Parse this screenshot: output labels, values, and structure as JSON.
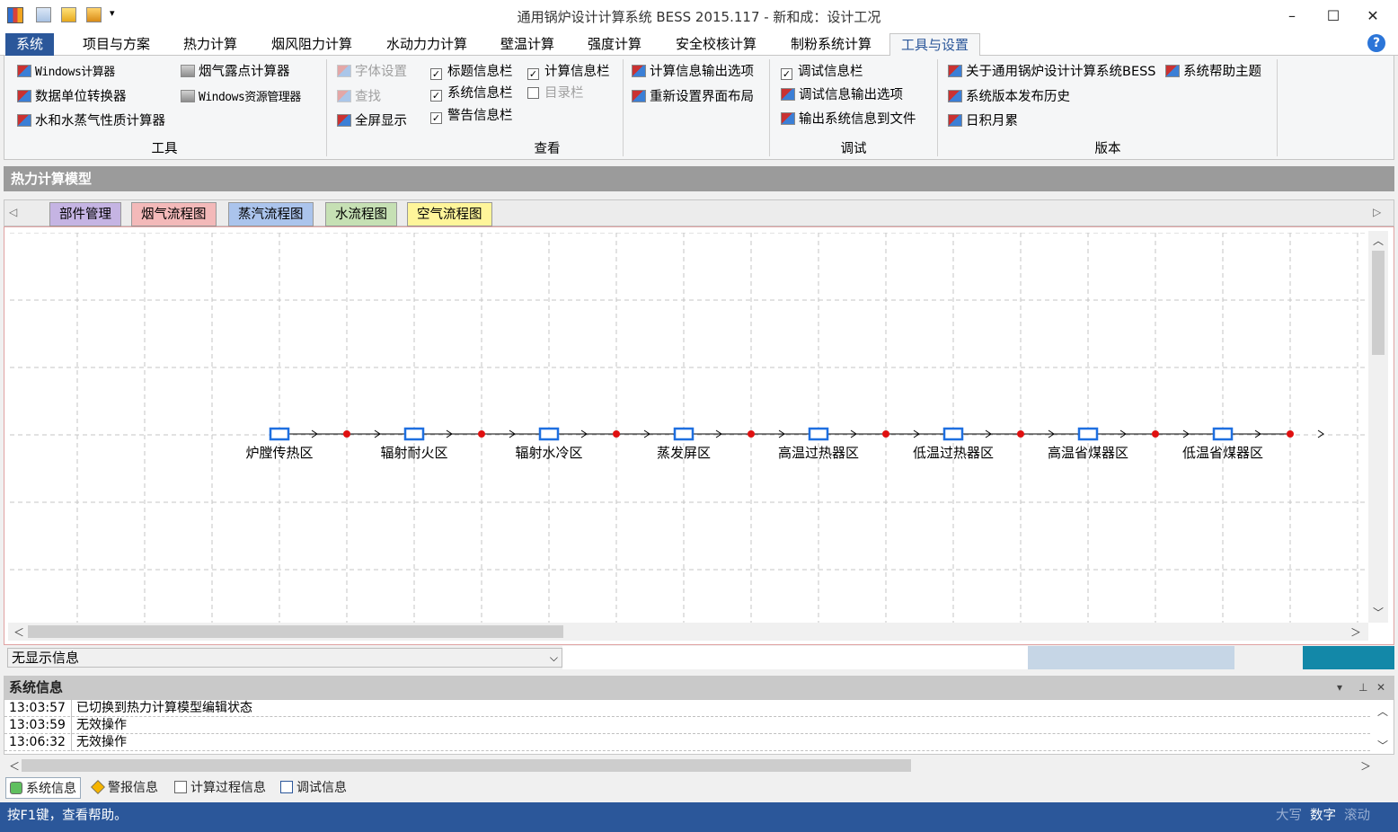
{
  "window": {
    "title": "通用锅炉设计计算系统 BESS 2015.117 - 新和成：设计工况",
    "minimize": "–",
    "maximize": "☐",
    "close": "✕",
    "help": "?"
  },
  "menu_tabs": [
    "系统",
    "项目与方案",
    "热力计算",
    "烟风阻力计算",
    "水动力力计算",
    "壁温计算",
    "强度计算",
    "安全校核计算",
    "制粉系统计算",
    "工具与设置"
  ],
  "ribbon": {
    "tools": {
      "label": "工具",
      "items": [
        "Windows计算器",
        "数据单位转换器",
        "水和水蒸气性质计算器",
        "烟气露点计算器",
        "Windows资源管理器"
      ]
    },
    "view": {
      "label": "查看",
      "items": [
        "字体设置",
        "查找",
        "全屏显示"
      ],
      "checks": [
        {
          "label": "标题信息栏",
          "checked": true
        },
        {
          "label": "系统信息栏",
          "checked": true
        },
        {
          "label": "警告信息栏",
          "checked": true
        },
        {
          "label": "计算信息栏",
          "checked": true
        },
        {
          "label": "目录栏",
          "checked": false
        }
      ],
      "more": [
        "计算信息输出选项",
        "重新设置界面布局"
      ]
    },
    "debug": {
      "label": "调试",
      "check": "调试信息栏",
      "items": [
        "调试信息输出选项",
        "输出系统信息到文件"
      ]
    },
    "version": {
      "label": "版本",
      "items": [
        "关于通用锅炉设计计算系统BESS",
        "系统版本发布历史",
        "日积月累",
        "系统帮助主题"
      ]
    }
  },
  "model_panel": {
    "title": "热力计算模型",
    "tabs": [
      {
        "label": "部件管理",
        "color": "#c5b4e3"
      },
      {
        "label": "烟气流程图",
        "color": "#f3b9b9"
      },
      {
        "label": "蒸汽流程图",
        "color": "#abc4ec"
      },
      {
        "label": "水流程图",
        "color": "#c6e0b4"
      },
      {
        "label": "空气流程图",
        "color": "#fff59a"
      }
    ],
    "flow_nodes": [
      "炉膛传热区",
      "辐射耐火区",
      "辐射水冷区",
      "蒸发屏区",
      "高温过热器区",
      "低温过热器区",
      "高温省煤器区",
      "低温省煤器区"
    ]
  },
  "info_select": "无显示信息",
  "system_info": {
    "title": "系统信息",
    "logs": [
      {
        "time": "13:03:57",
        "msg": "已切换到热力计算模型编辑状态"
      },
      {
        "time": "13:03:59",
        "msg": "无效操作"
      },
      {
        "time": "13:06:32",
        "msg": "无效操作"
      }
    ]
  },
  "bottom_tabs": [
    "系统信息",
    "警报信息",
    "计算过程信息",
    "调试信息"
  ],
  "status": {
    "text": "按F1键，查看帮助。",
    "caps": "大写",
    "num": "数字",
    "scroll": "滚动"
  },
  "colors": {
    "accent": "#2b579a",
    "node_box": "#1e6fe0",
    "node_dot": "#e01010"
  }
}
